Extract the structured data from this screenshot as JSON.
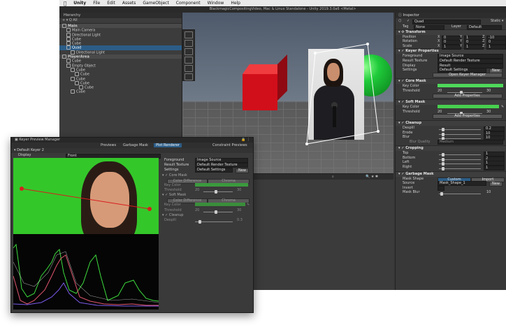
{
  "menubar": {
    "apple": "",
    "items": [
      "Unity",
      "File",
      "Edit",
      "Assets",
      "GameObject",
      "Component",
      "Window",
      "Help"
    ]
  },
  "window_title": "BlackmagicCompositingVideo, Mac & Linux Standalone - Unity 2019.3.0a6 <Metal>",
  "hierarchy": {
    "tab": "Hierarchy",
    "toolbar": "+ ▾  Q All",
    "rows": [
      {
        "label": "Main",
        "indent": 0,
        "bold": true
      },
      {
        "label": "Main Camera",
        "indent": 1
      },
      {
        "label": "Directional Light",
        "indent": 1
      },
      {
        "label": "Cube",
        "indent": 1
      },
      {
        "label": "Cube",
        "indent": 1
      },
      {
        "label": "Quad",
        "indent": 1,
        "selected": true
      },
      {
        "label": "Directional Light",
        "indent": 2
      },
      {
        "label": "PlayerArea",
        "indent": 0,
        "bold": true
      },
      {
        "label": "Cube",
        "indent": 1
      },
      {
        "label": "Empty Object",
        "indent": 1
      },
      {
        "label": "Cube",
        "indent": 2
      },
      {
        "label": "Cube",
        "indent": 3
      },
      {
        "label": "Cube",
        "indent": 2
      },
      {
        "label": "Cube",
        "indent": 3
      },
      {
        "label": "Cube",
        "indent": 4
      },
      {
        "label": "Cube",
        "indent": 2
      }
    ]
  },
  "inspector": {
    "tab": "Inspector",
    "object_name": "Quad",
    "static_label": "Static ▾",
    "tag_label": "Tag",
    "tag_value": "None",
    "layer_label": "Layer",
    "layer_value": "Default",
    "transform": {
      "title": "Transform",
      "rows": [
        {
          "label": "Position",
          "x": "0",
          "y": "1",
          "z": "-10"
        },
        {
          "label": "Rotation",
          "x": "0",
          "y": "0",
          "z": "0"
        },
        {
          "label": "Scale",
          "x": "1",
          "y": "1",
          "z": "1"
        }
      ]
    },
    "keyer": {
      "title": "Keyer Properties",
      "foreground_label": "Foreground",
      "foreground_value": "Image Source",
      "result_label": "Result Texture",
      "result_value": "Default Render Texture",
      "display_label": "Display",
      "display_value": "Result",
      "settings_label": "Settings",
      "settings_value": "Default Settings",
      "new_btn": "New",
      "open_btn": "Open Keyer Manager"
    },
    "core_mask": {
      "title": "Core Mask",
      "key_color_label": "Key Color",
      "key_color": "#4ed85a",
      "threshold_label": "Threshold",
      "threshold_min": "20",
      "threshold_max": "30",
      "add_btn": "Add Properties"
    },
    "soft_mask": {
      "title": "Soft Mask",
      "key_color_label": "Key Color",
      "key_color": "#47d04e",
      "threshold_label": "Threshold",
      "threshold_min": "20",
      "threshold_max": "30",
      "add_btn": "Add Properties"
    },
    "cleanup": {
      "title": "Cleanup",
      "rows": [
        {
          "label": "Despill",
          "value": "0.2"
        },
        {
          "label": "Erode",
          "value": "10"
        },
        {
          "label": "Blur",
          "value": "10"
        }
      ],
      "blur_quality_label": "Blur Quality",
      "blur_quality_value": "Medium"
    },
    "cropping": {
      "title": "Cropping",
      "rows": [
        {
          "label": "Top",
          "value": "1"
        },
        {
          "label": "Bottom",
          "value": "2"
        },
        {
          "label": "Left",
          "value": "1"
        },
        {
          "label": "Right",
          "value": "1"
        }
      ]
    },
    "garbage_mask": {
      "title": "Garbage Mask",
      "shape_label": "Mask Shape",
      "shape_custom": "Custom",
      "shape_import": "Import",
      "source_label": "Source",
      "source_value": "Mask_Shape_1",
      "new_btn": "New",
      "invert_label": "Invert",
      "blur_label": "Mask Blur",
      "blur_value": "10"
    }
  },
  "keyer_manager": {
    "title": "Keyer Preview Manager",
    "tabs": [
      "Previews",
      "Garbage Mask",
      "Plot Renderer",
      "Constraint Previews"
    ],
    "active_tab": "Plot Renderer",
    "keyer_label": "Default Keyer 2",
    "display_label": "Display",
    "display_value": "Front",
    "foreground_label": "Foreground",
    "foreground_value": "Image Source",
    "result_label": "Result Texture",
    "result_value": "Default Render Texture",
    "settings_label": "Settings",
    "settings_value": "Default Settings",
    "new_btn": "New",
    "core_mask": {
      "title": "Core Mask",
      "mode_a": "Color Difference",
      "mode_b": "Chroma",
      "key_color_label": "Key Color",
      "threshold_label": "Threshold",
      "t_min": "20",
      "t_max": "30"
    },
    "soft_mask": {
      "title": "Soft Mask",
      "mode_a": "Color Difference",
      "mode_b": "Chroma",
      "key_color_label": "Key Color",
      "threshold_label": "Threshold",
      "t_min": "20",
      "t_max": "30"
    },
    "cleanup": {
      "title": "Cleanup",
      "despill_label": "Despill",
      "despill_value": "0.3"
    },
    "colors": {
      "green_screen": "#34c72a",
      "active_tab": "#2c5d87"
    }
  }
}
